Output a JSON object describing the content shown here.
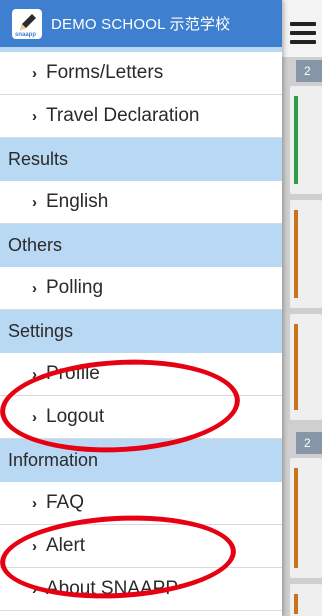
{
  "header": {
    "school_name": "DEMO SCHOOL 示范学校",
    "logo_text": "snaapp",
    "logo_icon": "pencil-icon"
  },
  "drawer": {
    "rows": [
      {
        "kind": "item",
        "label": "Forms/Letters"
      },
      {
        "kind": "item",
        "label": "Travel Declaration"
      },
      {
        "kind": "section",
        "label": "Results"
      },
      {
        "kind": "item",
        "label": "English"
      },
      {
        "kind": "section",
        "label": "Others"
      },
      {
        "kind": "item",
        "label": "Polling"
      },
      {
        "kind": "section",
        "label": "Settings"
      },
      {
        "kind": "item",
        "label": "Profile"
      },
      {
        "kind": "item",
        "label": "Logout"
      },
      {
        "kind": "section",
        "label": "Information"
      },
      {
        "kind": "item",
        "label": "FAQ"
      },
      {
        "kind": "item",
        "label": "Alert"
      },
      {
        "kind": "item",
        "label": "About SNAAPP"
      }
    ],
    "chevron": "›"
  },
  "background": {
    "date_chips": [
      "2",
      "2"
    ],
    "menu_icon": "hamburger-icon"
  },
  "colors": {
    "header": "#3f7fd0",
    "section": "#b9d8f3",
    "annotation": "#e60012",
    "bar_green": "#2e9b4a",
    "bar_orange": "#c8741e"
  }
}
